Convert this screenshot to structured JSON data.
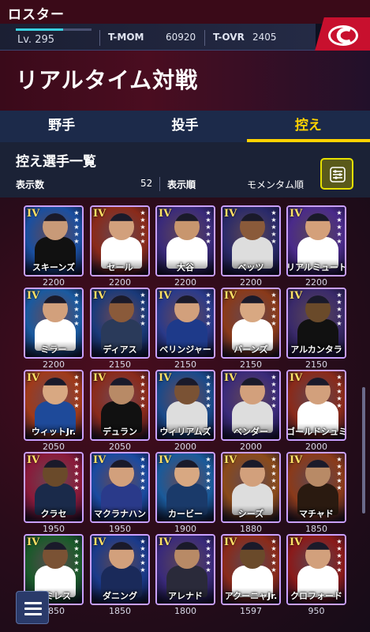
{
  "topbar": {
    "title": "ロスター"
  },
  "stats": {
    "level": "Lv. 295",
    "tmom_label": "T-MOM",
    "tmom_value": "60920",
    "tovr_label": "T-OVR",
    "tovr_value": "2405"
  },
  "header": {
    "title": "リアルタイム対戦"
  },
  "tabs": [
    {
      "label": "野手",
      "active": false
    },
    {
      "label": "投手",
      "active": false
    },
    {
      "label": "控え",
      "active": true
    }
  ],
  "list": {
    "title": "控え選手一覧",
    "count_label": "表示数",
    "count_value": "52",
    "sort_label": "表示順",
    "sort_value": "モメンタム順"
  },
  "colors": {
    "accent": "#ffd200",
    "tab_bg": "#1c2a4a",
    "team_red": "#c8102e"
  },
  "cards": [
    {
      "iv": "IV",
      "name": "スキーンズ",
      "score": "2200",
      "bg": "#1a4fa0",
      "skin": "#c89a78",
      "jersey": "#111111"
    },
    {
      "iv": "IV",
      "name": "セール",
      "score": "2200",
      "bg": "#8a2a1a",
      "skin": "#d2a07c",
      "jersey": "#ffffff"
    },
    {
      "iv": "IV",
      "name": "大谷",
      "score": "2200",
      "bg": "#3a2a7a",
      "skin": "#c8966e",
      "jersey": "#ffffff"
    },
    {
      "iv": "IV",
      "name": "ベッツ",
      "score": "2200",
      "bg": "#2a2a6a",
      "skin": "#8a5a3a",
      "jersey": "#dddddd"
    },
    {
      "iv": "IV",
      "name": "リアルミュート",
      "score": "2200",
      "bg": "#4a2a8a",
      "skin": "#d4a07a",
      "jersey": "#ffffff"
    },
    {
      "iv": "IV",
      "name": "ミラー",
      "score": "2200",
      "bg": "#1a5aa0",
      "skin": "#d2a07c",
      "jersey": "#ffffff"
    },
    {
      "iv": "IV",
      "name": "ディアス",
      "score": "2150",
      "bg": "#1a3a7a",
      "skin": "#8a5a3a",
      "jersey": "#2a3a5a"
    },
    {
      "iv": "IV",
      "name": "ベリンジャー",
      "score": "2150",
      "bg": "#2a3a8a",
      "skin": "#d2a07c",
      "jersey": "#1e3a8a"
    },
    {
      "iv": "IV",
      "name": "バーンズ",
      "score": "2150",
      "bg": "#8a3a1a",
      "skin": "#d8a882",
      "jersey": "#ffffff"
    },
    {
      "iv": "IV",
      "name": "アルカンタラ",
      "score": "2150",
      "bg": "#3a2a6a",
      "skin": "#6a4a2a",
      "jersey": "#111111"
    },
    {
      "iv": "IV",
      "name": "ウィットJr.",
      "score": "2050",
      "bg": "#a03a1a",
      "skin": "#d8a882",
      "jersey": "#1e4a9a"
    },
    {
      "iv": "IV",
      "name": "デュラン",
      "score": "2050",
      "bg": "#8a2a1a",
      "skin": "#b88a66",
      "jersey": "#111111"
    },
    {
      "iv": "IV",
      "name": "ウィリアムズ",
      "score": "2000",
      "bg": "#1a4a8a",
      "skin": "#7a5234",
      "jersey": "#dddddd"
    },
    {
      "iv": "IV",
      "name": "ベンダー",
      "score": "2000",
      "bg": "#3a2a7a",
      "skin": "#d2a07c",
      "jersey": "#dddddd"
    },
    {
      "iv": "IV",
      "name": "ゴールドシュミット",
      "score": "2000",
      "bg": "#8a2a1a",
      "skin": "#d2a07c",
      "jersey": "#ffffff"
    },
    {
      "iv": "IV",
      "name": "クラセ",
      "score": "1950",
      "bg": "#8a1a3a",
      "skin": "#6a4a2a",
      "jersey": "#1a2a4a"
    },
    {
      "iv": "IV",
      "name": "マクラナハン",
      "score": "1950",
      "bg": "#1a4aa0",
      "skin": "#d2a07c",
      "jersey": "#2a3a8a"
    },
    {
      "iv": "IV",
      "name": "カービー",
      "score": "1900",
      "bg": "#1a5a9a",
      "skin": "#d8a882",
      "jersey": "#1a3a6a"
    },
    {
      "iv": "IV",
      "name": "シーズ",
      "score": "1880",
      "bg": "#8a4a1a",
      "skin": "#d2a07c",
      "jersey": "#dddddd"
    },
    {
      "iv": "IV",
      "name": "マチャド",
      "score": "1850",
      "bg": "#8a3a1a",
      "skin": "#b88a66",
      "jersey": "#2a1a10"
    },
    {
      "iv": "IV",
      "name": "ラミレス",
      "score": "1850",
      "bg": "#1a5a2a",
      "skin": "#7a5234",
      "jersey": "#ffffff"
    },
    {
      "iv": "IV",
      "name": "ダニング",
      "score": "1850",
      "bg": "#1a3a8a",
      "skin": "#d2a07c",
      "jersey": "#1a2a5a"
    },
    {
      "iv": "IV",
      "name": "アレナド",
      "score": "1800",
      "bg": "#3a2a7a",
      "skin": "#b88a66",
      "jersey": "#2a2a3a"
    },
    {
      "iv": "IV",
      "name": "アクーニャJr.",
      "score": "1597",
      "bg": "#8a2a1a",
      "skin": "#6a4a2a",
      "jersey": "#ffffff"
    },
    {
      "iv": "IV",
      "name": "クロフォード",
      "score": "950",
      "bg": "#8a1a1a",
      "skin": "#d2a07c",
      "jersey": "#ffffff"
    }
  ]
}
